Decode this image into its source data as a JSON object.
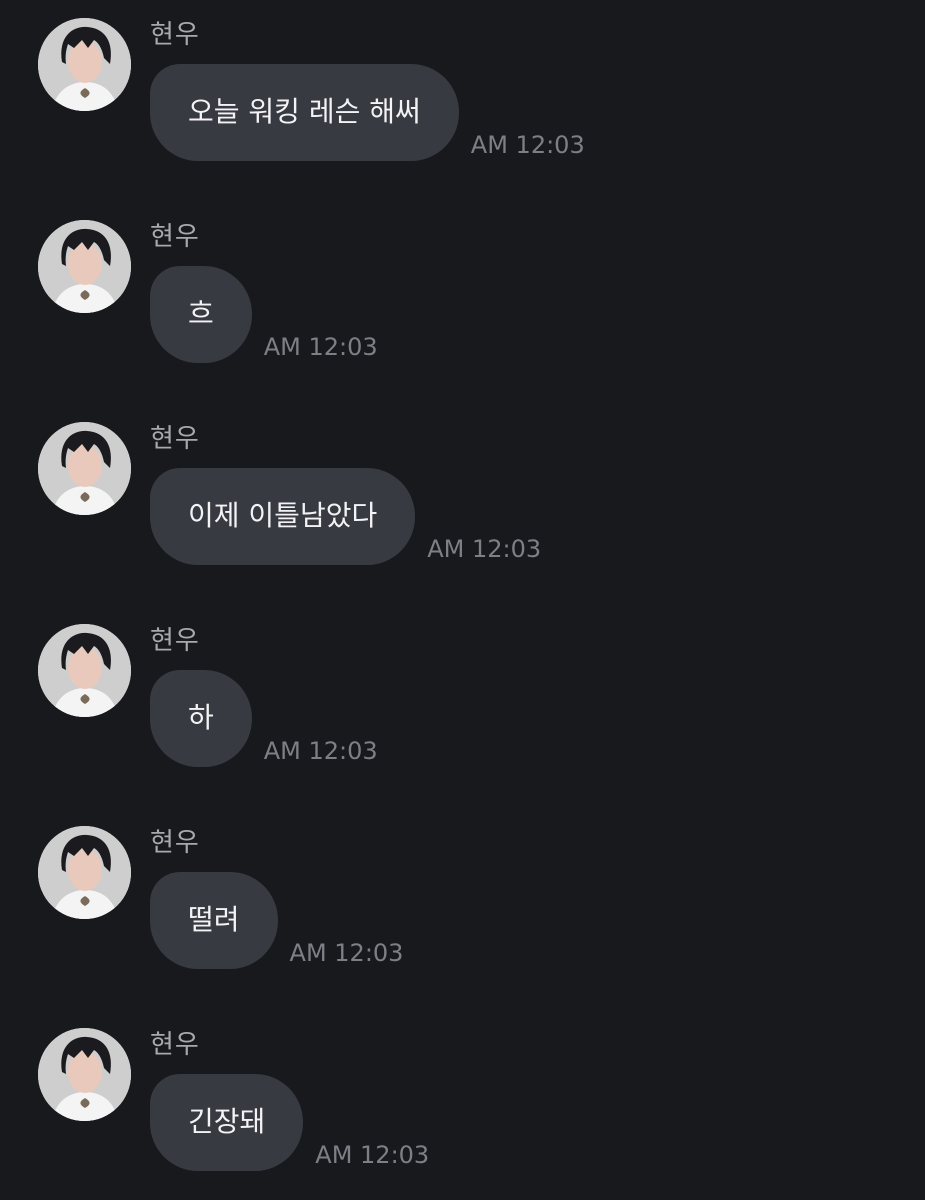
{
  "messages": [
    {
      "sender": "현우",
      "text": "오늘 워킹 레슨 해써",
      "time": "AM 12:03"
    },
    {
      "sender": "현우",
      "text": "흐",
      "time": "AM 12:03"
    },
    {
      "sender": "현우",
      "text": "이제 이틀남았다",
      "time": "AM 12:03"
    },
    {
      "sender": "현우",
      "text": "하",
      "time": "AM 12:03"
    },
    {
      "sender": "현우",
      "text": "떨려",
      "time": "AM 12:03"
    },
    {
      "sender": "현우",
      "text": "긴장돼",
      "time": "AM 12:03"
    }
  ],
  "colors": {
    "background": "#18191d",
    "bubble": "#383a42",
    "bubble_text": "#f3f3f5",
    "sender_text": "#a8a9ad",
    "time_text": "#7d7f86"
  }
}
